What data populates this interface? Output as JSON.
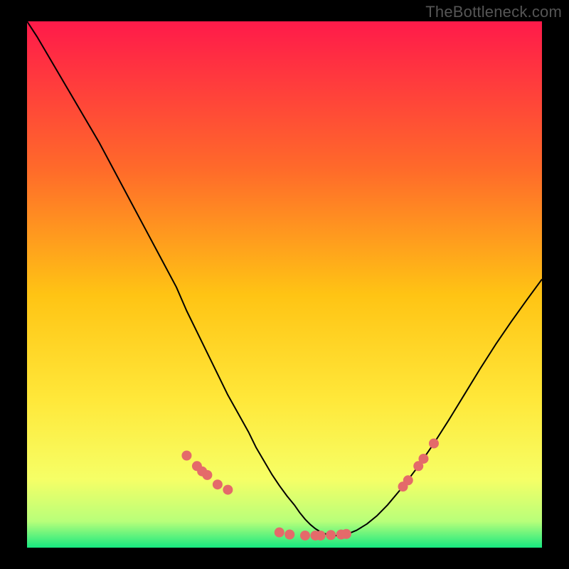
{
  "watermark": "TheBottleneck.com",
  "colors": {
    "background": "#000000",
    "gradient_top": "#ff1a4a",
    "gradient_mid_upper": "#ff6a2a",
    "gradient_mid": "#ffc414",
    "gradient_mid_lower": "#ffe83a",
    "gradient_lower": "#f6ff66",
    "gradient_near_bottom": "#b8ff7a",
    "gradient_bottom": "#17e880",
    "curve": "#000000",
    "marker": "#e46a6a"
  },
  "chart_data": {
    "type": "line",
    "title": "",
    "xlabel": "",
    "ylabel": "",
    "xlim": [
      0,
      100
    ],
    "ylim": [
      0,
      100
    ],
    "x": [
      0,
      2,
      5,
      8,
      11,
      14,
      17,
      20,
      23,
      26,
      29,
      31,
      33,
      35,
      37,
      39,
      41,
      43,
      44.5,
      46,
      47.5,
      49,
      50.5,
      52,
      53,
      54,
      55,
      56,
      57,
      58,
      59,
      60,
      61,
      62.5,
      64,
      66,
      68,
      70,
      73,
      76,
      79,
      82,
      85,
      88,
      91,
      94,
      97,
      100
    ],
    "values": [
      100,
      97,
      92,
      87,
      82,
      77,
      71.5,
      66,
      60.5,
      55,
      49.5,
      45,
      41,
      37,
      33,
      29,
      25.5,
      22,
      19,
      16.5,
      14,
      11.8,
      9.8,
      8,
      6.6,
      5.4,
      4.4,
      3.6,
      3,
      2.6,
      2.4,
      2.3,
      2.4,
      2.7,
      3.3,
      4.5,
      6.1,
      8.1,
      11.6,
      15.5,
      19.8,
      24.4,
      29.2,
      34,
      38.6,
      42.9,
      47,
      51
    ],
    "series": [
      {
        "name": "bottleneck-curve",
        "x": "shared",
        "values": "shared"
      }
    ],
    "markers": {
      "name": "highlighted-points",
      "x": [
        31,
        33,
        34,
        35,
        37,
        39,
        49,
        51,
        54,
        56,
        57,
        59,
        61,
        62,
        73,
        74,
        76,
        77,
        79
      ],
      "y": [
        17.5,
        15.5,
        14.5,
        13.8,
        12,
        11,
        2.9,
        2.5,
        2.3,
        2.3,
        2.3,
        2.4,
        2.5,
        2.6,
        11.6,
        12.8,
        15.5,
        16.9,
        19.8
      ]
    }
  }
}
